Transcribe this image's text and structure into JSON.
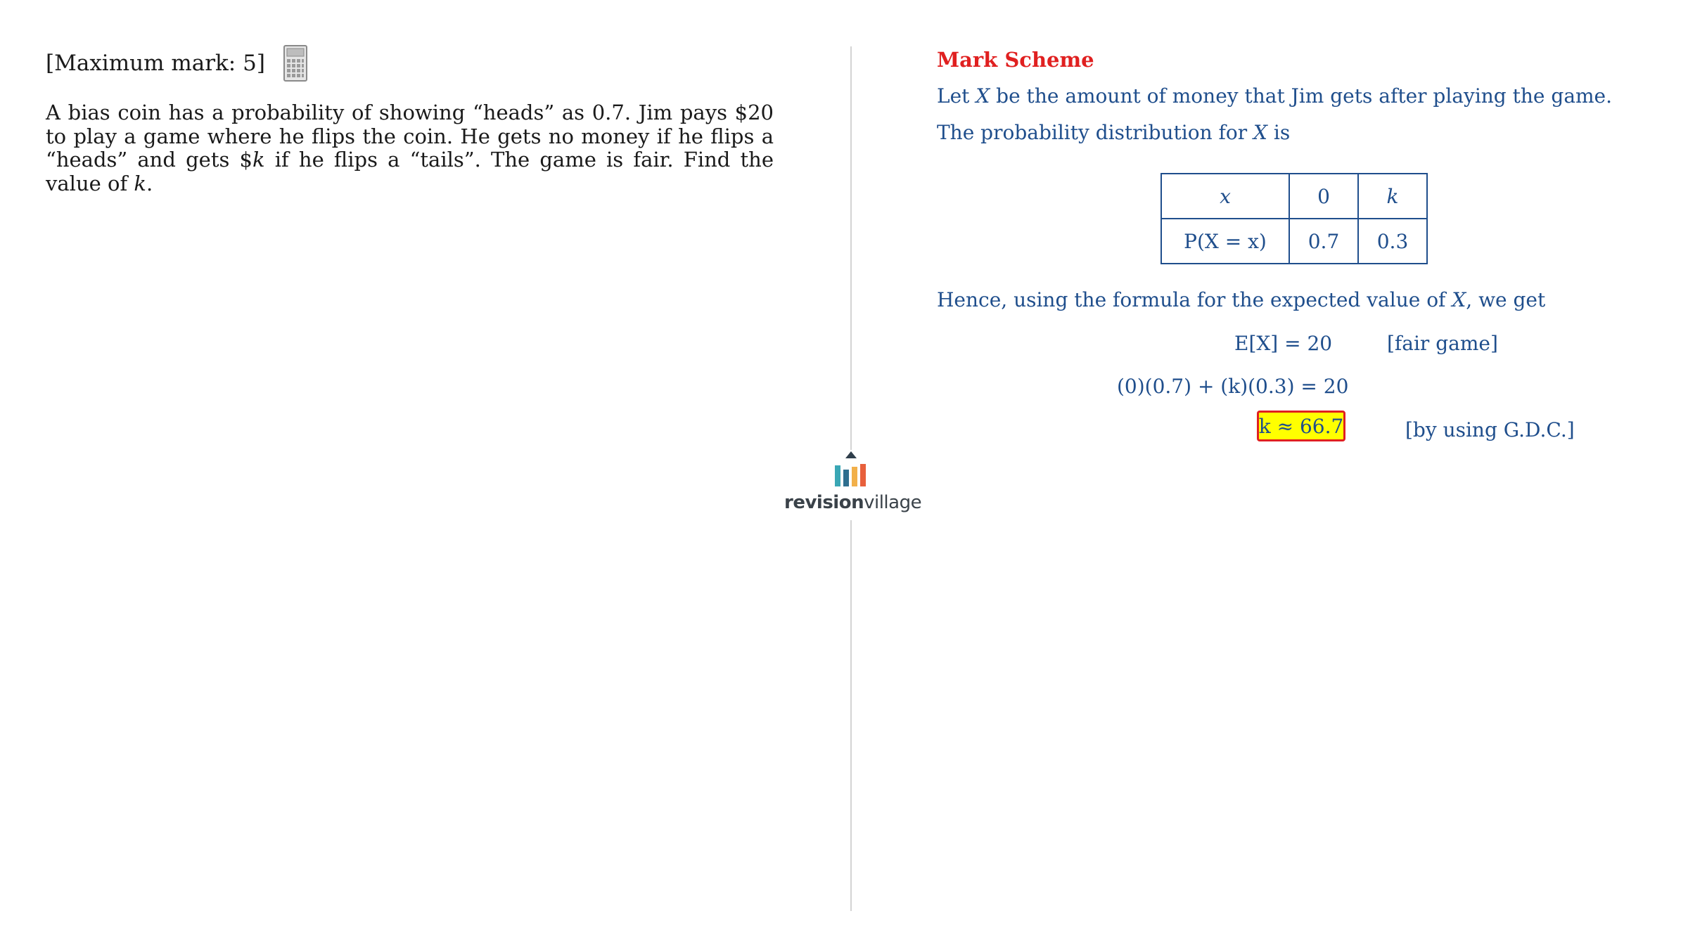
{
  "question": {
    "max_mark": "[Maximum mark: 5]",
    "calculator_icon": "calculator-icon",
    "text_part1": "A bias coin has a probability of showing “heads” as 0.7. Jim pays $20 to play a game where he flips the coin. He gets no money if he flips a “heads” and gets $",
    "var_k": "k",
    "text_part2": " if he flips a “tails”. The game is fair. Find the value of ",
    "text_end": "."
  },
  "logo": {
    "text_bold": "revision",
    "text_light": "village"
  },
  "mark_scheme": {
    "title": "Mark Scheme",
    "line1_a": "Let ",
    "line1_var": "X",
    "line1_b": " be the amount of money that Jim gets after playing the game.",
    "line2_a": "The probability distribution for ",
    "line2_var": "X",
    "line2_b": " is",
    "table": {
      "row1": [
        "x",
        "0",
        "k"
      ],
      "row2": [
        "P(X = x)",
        "0.7",
        "0.3"
      ]
    },
    "line3_a": "Hence, using the formula for the expected value of ",
    "line3_var": "X",
    "line3_b": ", we get",
    "eq1": "E[X] = 20",
    "eq1_note": "[fair game]",
    "eq2": "(0)(0.7) + (k)(0.3) = 20",
    "answer": "k ≈ 66.7",
    "answer_note": "[by using G.D.C.]"
  },
  "colors": {
    "scheme_text": "#1f4e8c",
    "title_red": "#e02020",
    "highlight": "#ffff00"
  }
}
